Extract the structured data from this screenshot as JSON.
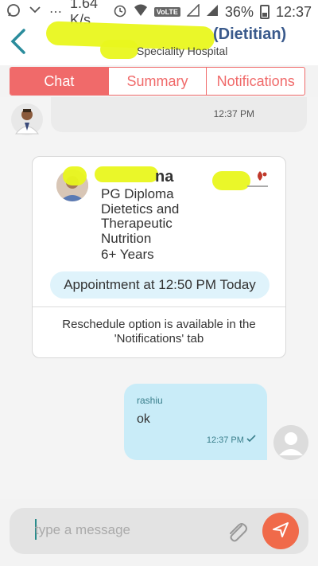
{
  "status_bar": {
    "speed": "1.64 K/s",
    "volte": "VoLTE",
    "battery": "36%",
    "time": "12:37"
  },
  "header": {
    "doctor_name": "(Dietitian)",
    "hospital": "Speciality Hospital"
  },
  "tabs": [
    {
      "label": "Chat",
      "active": true
    },
    {
      "label": "Summary",
      "active": false
    },
    {
      "label": "Notifications",
      "active": false
    }
  ],
  "messages": {
    "doctor_msg_time": "12:37 PM",
    "user_msg": {
      "sender": "rashiu",
      "text": "ok",
      "time": "12:37 PM"
    }
  },
  "card": {
    "name": "na",
    "details": [
      "PG Diploma",
      "Dietetics and",
      "Therapeutic",
      "Nutrition",
      "6+ Years"
    ],
    "appointment": "Appointment at 12:50 PM Today",
    "reschedule": [
      "Reschedule option is available in the",
      "'Notifications' tab"
    ]
  },
  "composer": {
    "placeholder": "type a message"
  },
  "colors": {
    "accent": "#f06a6a",
    "header_text": "#3a5a8c",
    "user_bubble": "#c9ecf8",
    "appointment_pill": "#dff3fb",
    "send_button": "#f06a4a"
  }
}
